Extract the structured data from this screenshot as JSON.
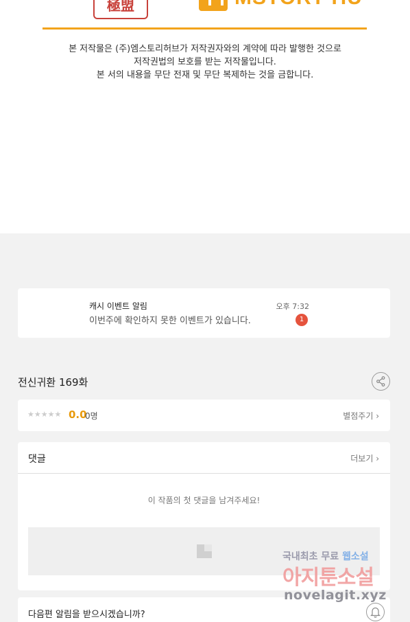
{
  "header": {
    "seal_text": "極盟",
    "brand_name": "MSTORY HUB",
    "notice_lines": [
      "본 저작물은 (주)엠스토리허브가 저작권자와의 계약에 따라 발행한 것으로",
      "저작권법의 보호를 받는 저작물입니다.",
      "본 서의 내용을 무단 전재 및 무단 복제하는 것을 금합니다."
    ]
  },
  "event_notice": {
    "title": "캐시 이벤트 알림",
    "message": "이번주에 확인하지 못한 이벤트가 있습니다.",
    "time": "오후 7:32",
    "badge_count": "1"
  },
  "episode": {
    "title": "전신귀환 169화",
    "share_icon": "share-icon"
  },
  "rating": {
    "stars": "★★★★★",
    "score": "0.0",
    "count": "0명",
    "rate_link": "별점주기 ›"
  },
  "comments": {
    "label": "댓글",
    "more": "더보기 ›",
    "empty_message": "이 작품의 첫 댓글을 남겨주세요!"
  },
  "next_episode": {
    "label": "다음편 알림을 받으시겠습니까?",
    "bell_icon": "bell-icon"
  },
  "watermark": {
    "line1_prefix": "국내최초 무료 ",
    "line1_highlight": "웹소설",
    "line2": "아지툰소설",
    "line3": "novelagit.xyz"
  },
  "colors": {
    "brand_orange": "#f2a31b",
    "seal_red": "#c8413a",
    "badge_red": "#e5533d",
    "score_orange": "#e89a0c",
    "background_gray": "#f2f2f2"
  }
}
